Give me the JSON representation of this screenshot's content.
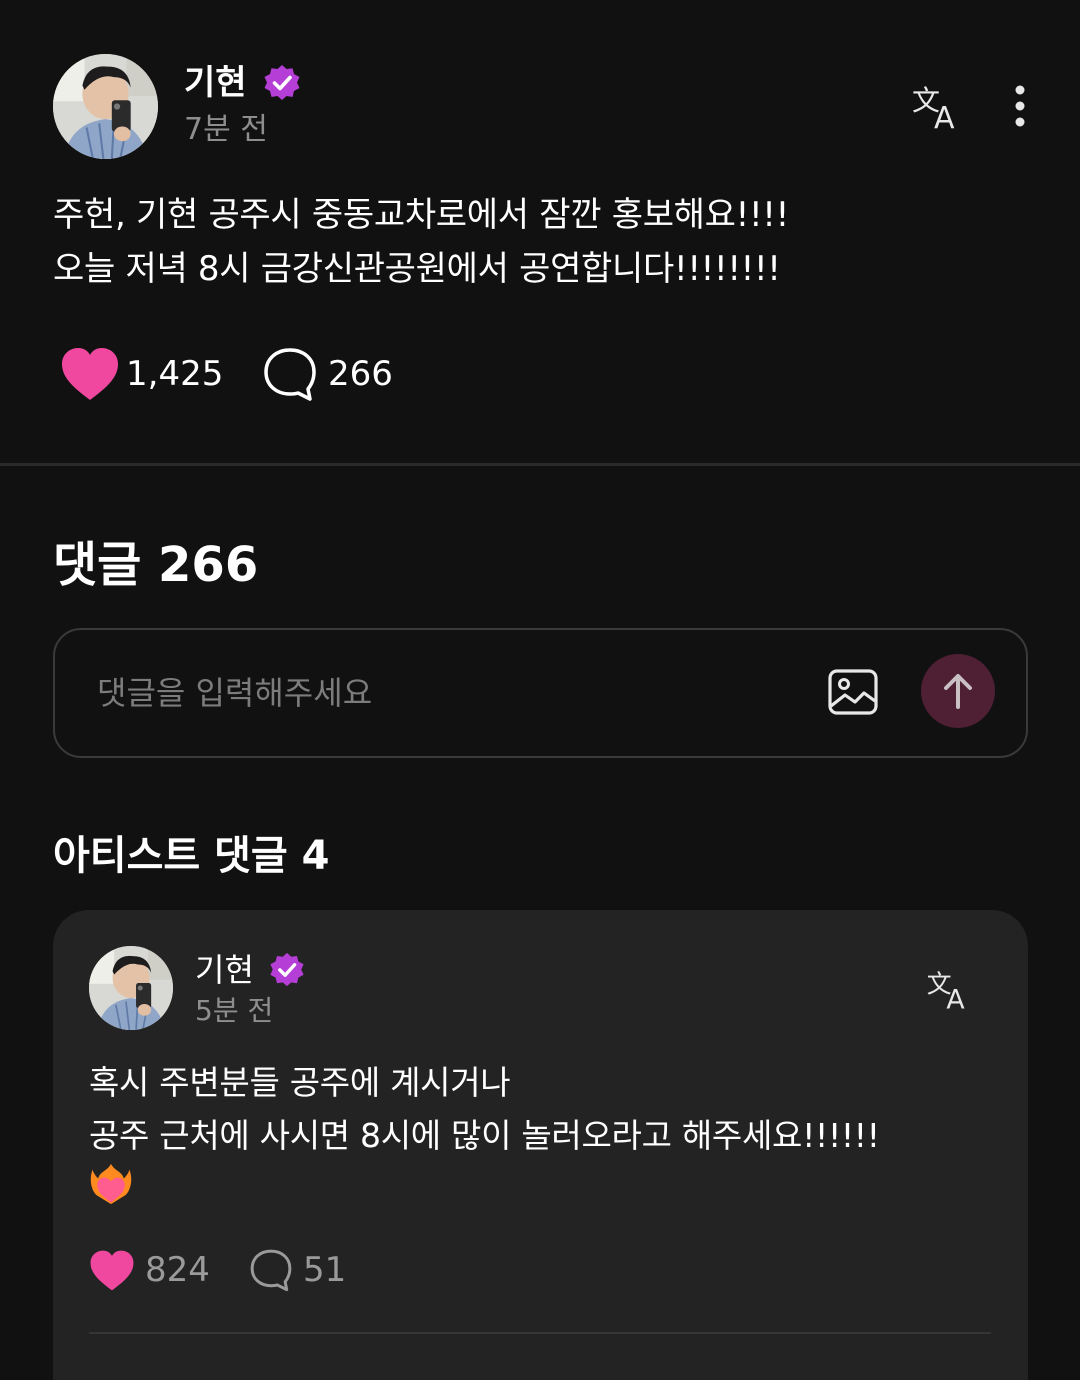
{
  "colors": {
    "background": "#111111",
    "like": "#f0489f",
    "verified": "#b43ed6",
    "send_button": "#4f1f33",
    "card": "#232323",
    "muted_text": "#8e8e8e"
  },
  "post": {
    "author": "기현",
    "time": "7분 전",
    "body": "주헌, 기현 공주시 중동교차로에서 잠깐 홍보해요!!!!\n오늘 저녁 8시 금강신관공원에서 공연합니다!!!!!!!!",
    "likes": "1,425",
    "comments": "266",
    "icons": {
      "verified": "verified-badge-icon",
      "translate": "translate-icon",
      "more": "more-vertical-icon",
      "like": "heart-icon",
      "comment": "comment-bubble-icon"
    }
  },
  "comments_section": {
    "title": "댓글 266",
    "input_placeholder": "댓글을 입력해주세요",
    "input_value": "",
    "image_icon": "image-icon",
    "send_icon": "arrow-up-icon"
  },
  "artist_comments": {
    "title": "아티스트 댓글 4",
    "items": [
      {
        "author": "기현",
        "time": "5분 전",
        "body": "혹시 주변분들 공주에 계시거나\n공주 근처에 사시면 8시에 많이 놀러오라고 해주세요!!!!!!",
        "emoji": "heart-on-fire-emoji",
        "likes": "824",
        "comments": "51"
      }
    ]
  }
}
